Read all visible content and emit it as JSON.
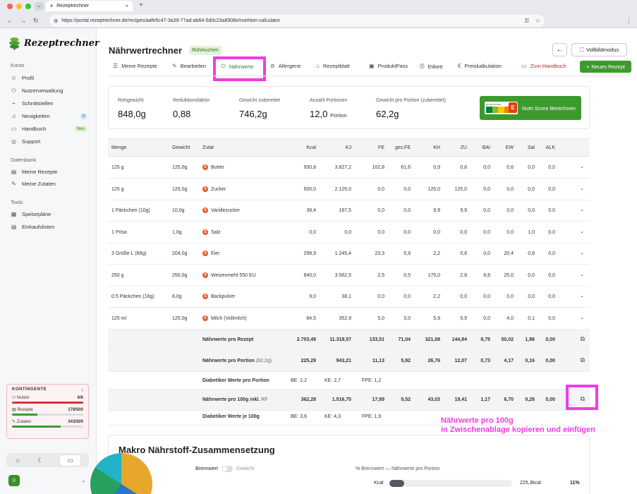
{
  "browser": {
    "tab_title": "Rezeptrechner",
    "url": "https://portal.rezeptrechner.de/recipes/aafe5c47-3a39-77ad-ab64-5d0c23a8908e/nutrition-calculator"
  },
  "sidebar": {
    "brand": "Rezeptrechner",
    "sections": {
      "konto": "Konto",
      "datenbank": "Datenbank",
      "tools": "Tools"
    },
    "konto_items": [
      {
        "label": "Profil",
        "icon": "user-icon"
      },
      {
        "label": "Nutzerverwaltung",
        "icon": "users-icon"
      },
      {
        "label": "Schnittstellen",
        "icon": "plug-icon"
      },
      {
        "label": "Neuigkeiten",
        "icon": "bell-icon",
        "badge": "3"
      },
      {
        "label": "Handbuch",
        "icon": "book-icon",
        "badge": "Neu"
      },
      {
        "label": "Support",
        "icon": "help-icon"
      }
    ],
    "datenbank_items": [
      {
        "label": "Meine Rezepte",
        "icon": "book-icon"
      },
      {
        "label": "Meine Zutaten",
        "icon": "carrot-icon"
      }
    ],
    "tools_items": [
      {
        "label": "Speisepläne",
        "icon": "calendar-icon"
      },
      {
        "label": "Einkaufslisten",
        "icon": "cart-icon"
      }
    ],
    "quota": {
      "title": "KONTINGENTE",
      "items": [
        {
          "label": "Nutzer",
          "value": "6/6",
          "fraction": 1.0,
          "color": "#d9303e"
        },
        {
          "label": "Rezepte",
          "value": "179/500",
          "fraction": 0.358,
          "color": "#3d9a2e"
        },
        {
          "label": "Zutaten",
          "value": "343/500",
          "fraction": 0.686,
          "color": "#3d9a2e"
        }
      ]
    }
  },
  "header": {
    "title": "Nährwertrechner",
    "recipe_chip": "Rührkuchen",
    "fullscreen": "Vollbildmodus",
    "new_recipe": "Neues Rezept",
    "tabs": [
      {
        "label": "Meine Rezepte"
      },
      {
        "label": "Bearbeiten"
      },
      {
        "label": "Nährwerte"
      },
      {
        "label": "Allergene"
      },
      {
        "label": "Rezeptblatt"
      },
      {
        "label": "ProduktPass"
      },
      {
        "label": "Etikett"
      },
      {
        "label": "Preiskalkulation"
      },
      {
        "label": "Zum Handbuch"
      }
    ]
  },
  "stats": {
    "rohgewicht": {
      "label": "Rohgewicht",
      "value": "848,0g"
    },
    "reduktion": {
      "label": "Reduktionsfaktor",
      "value": "0,88"
    },
    "gewicht": {
      "label": "Gewicht zubereitet",
      "value": "746,2g"
    },
    "portionen": {
      "label": "Anzahl Portionen",
      "value": "12,0",
      "unit": "Portion"
    },
    "portion_gewicht": {
      "label": "Gewicht pro Portion (zubereitet)",
      "value": "62,2g"
    },
    "nutri_button": "Nutri Score Berechnen",
    "nutri_grade": "E",
    "nutri_small": "NUTRI-SCORE"
  },
  "table": {
    "headers": [
      "Menge",
      "Gewicht",
      "Zutat",
      "Kcal",
      "KJ",
      "FE",
      "ges.FE",
      "KH",
      "ZU",
      "BAI",
      "EW",
      "Sal",
      "ALK"
    ],
    "rows": [
      {
        "menge": "125 g",
        "gewicht": "125,0g",
        "zutat": "Butter",
        "vals": [
          "930,8",
          "3.827,2",
          "102,8",
          "61,6",
          "0,9",
          "0,8",
          "0,0",
          "0,6",
          "0,0",
          "0,0"
        ]
      },
      {
        "menge": "125 g",
        "gewicht": "125,0g",
        "zutat": "Zucker",
        "vals": [
          "500,0",
          "2.125,0",
          "0,0",
          "0,0",
          "125,0",
          "125,0",
          "0,0",
          "0,0",
          "0,0",
          "0,0"
        ]
      },
      {
        "menge": "1 Päckchen (10g)",
        "gewicht": "10,0g",
        "zutat": "Vanillezucker",
        "vals": [
          "39,4",
          "167,5",
          "0,0",
          "0,0",
          "9,9",
          "9,9",
          "0,0",
          "0,0",
          "0,0",
          "0,0"
        ]
      },
      {
        "menge": "1 Prisa",
        "gewicht": "1,0g",
        "zutat": "Salz",
        "vals": [
          "0,0",
          "0,0",
          "0,0",
          "0,0",
          "0,0",
          "0,0",
          "0,0",
          "0,0",
          "1,0",
          "0,0"
        ]
      },
      {
        "menge": "3 Größe L (68g)",
        "gewicht": "204,0g",
        "zutat": "Eier",
        "vals": [
          "299,9",
          "1.245,4",
          "23,3",
          "5,9",
          "2,2",
          "0,6",
          "0,0",
          "20,4",
          "0,8",
          "0,0"
        ]
      },
      {
        "menge": "250 g",
        "gewicht": "250,0g",
        "zutat": "Weizenmehl 550 EU",
        "vals": [
          "840,0",
          "3.562,5",
          "2,5",
          "0,5",
          "175,0",
          "2,8",
          "8,8",
          "25,0",
          "0,0",
          "0,0"
        ]
      },
      {
        "menge": "0.5 Päckchen (16g)",
        "gewicht": "8,0g",
        "zutat": "Backpulver",
        "vals": [
          "9,0",
          "38,1",
          "0,0",
          "0,0",
          "2,2",
          "0,0",
          "0,0",
          "0,0",
          "0,0",
          "0,0"
        ]
      },
      {
        "menge": "125 ml",
        "gewicht": "125,0g",
        "zutat": "Milch (Vollmilch)",
        "vals": [
          "84,5",
          "352,9",
          "5,0",
          "3,0",
          "5,9",
          "5,9",
          "0,0",
          "4,0",
          "0,1",
          "0,0"
        ]
      }
    ],
    "sum_rezept": {
      "label": "Nährwerte pro Rezept",
      "vals": [
        "2.703,49",
        "11.318,57",
        "133,51",
        "71,04",
        "321,08",
        "144,84",
        "8,75",
        "50,02",
        "1,96",
        "0,00"
      ]
    },
    "sum_portion": {
      "label": "Nährwerte pro Portion",
      "sub": "(62,2g)",
      "vals": [
        "225,29",
        "943,21",
        "11,13",
        "5,92",
        "26,76",
        "12,07",
        "0,73",
        "4,17",
        "0,16",
        "0,00"
      ]
    },
    "diab_portion": {
      "label": "Diabetiker Werte pro Portion",
      "be": "BE: 2,2",
      "ke": "KE: 2,7",
      "fpe": "FPE: 1,2"
    },
    "sum_100g": {
      "label": "Nährwerte pro 100g inkl.",
      "sub": "RF",
      "vals": [
        "362,28",
        "1.516,75",
        "17,89",
        "9,52",
        "43,03",
        "19,41",
        "1,17",
        "6,70",
        "0,26",
        "0,00"
      ]
    },
    "diab_100g": {
      "label": "Diabetiker Werte je 100g",
      "be": "BE: 3,6",
      "ke": "KE: 4,3",
      "fpe": "FPE: 1,9"
    }
  },
  "annotation": {
    "line1": "Nährwerte pro 100g",
    "line2": "in Zwischenablage kopieren und einfügen"
  },
  "macro": {
    "title": "Makro Nährstoff-Zusammensetzung",
    "toggle_on": "Brennwert",
    "toggle_off": "Gewicht",
    "pct_label": "% Brennwert — Nährwerte pro Portion",
    "kcal_label": "Kcal",
    "kcal_value": "225,3kcal",
    "kcal_pct": "11%",
    "kcal_fraction": 0.11
  }
}
